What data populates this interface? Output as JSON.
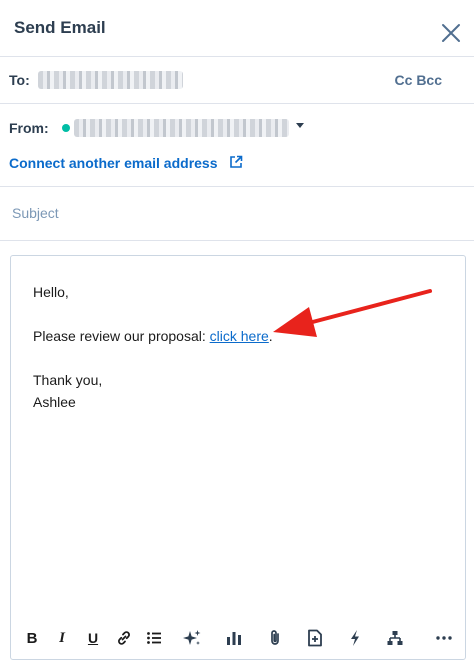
{
  "header": {
    "title": "Send Email"
  },
  "to": {
    "label": "To:",
    "cc_bcc_label": "Cc Bcc"
  },
  "from": {
    "label": "From:",
    "connect_label": "Connect another email address"
  },
  "subject": {
    "placeholder": "Subject",
    "value": ""
  },
  "message": {
    "greeting": "Hello,",
    "review_text": "Please review our proposal: ",
    "link_text": "click here",
    "after_link": ".",
    "closing": "Thank you,",
    "signature": "Ashlee"
  },
  "toolbar": {
    "bold_label": "B",
    "italic_label": "I",
    "underline_label": "U",
    "icons": [
      "link-icon",
      "bulleted-list-icon",
      "ai-sparkle-icon",
      "chart-icon",
      "attachment-icon",
      "insert-document-icon",
      "snippet-icon",
      "workflow-icon",
      "more-icon"
    ]
  },
  "colors": {
    "accent": "#0b6bcb",
    "status_dot": "#00bda5",
    "annotation_arrow": "#e8231c",
    "border": "#dfe3eb",
    "text": "#2d3e50"
  }
}
